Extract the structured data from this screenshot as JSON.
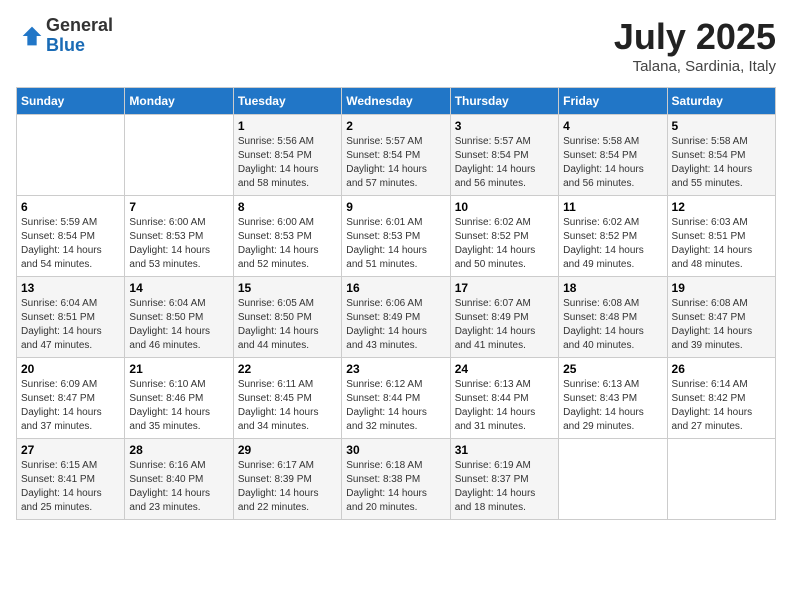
{
  "header": {
    "logo_line1": "General",
    "logo_line2": "Blue",
    "month": "July 2025",
    "location": "Talana, Sardinia, Italy"
  },
  "weekdays": [
    "Sunday",
    "Monday",
    "Tuesday",
    "Wednesday",
    "Thursday",
    "Friday",
    "Saturday"
  ],
  "weeks": [
    [
      {
        "day": "",
        "sunrise": "",
        "sunset": "",
        "daylight": ""
      },
      {
        "day": "",
        "sunrise": "",
        "sunset": "",
        "daylight": ""
      },
      {
        "day": "1",
        "sunrise": "Sunrise: 5:56 AM",
        "sunset": "Sunset: 8:54 PM",
        "daylight": "Daylight: 14 hours and 58 minutes."
      },
      {
        "day": "2",
        "sunrise": "Sunrise: 5:57 AM",
        "sunset": "Sunset: 8:54 PM",
        "daylight": "Daylight: 14 hours and 57 minutes."
      },
      {
        "day": "3",
        "sunrise": "Sunrise: 5:57 AM",
        "sunset": "Sunset: 8:54 PM",
        "daylight": "Daylight: 14 hours and 56 minutes."
      },
      {
        "day": "4",
        "sunrise": "Sunrise: 5:58 AM",
        "sunset": "Sunset: 8:54 PM",
        "daylight": "Daylight: 14 hours and 56 minutes."
      },
      {
        "day": "5",
        "sunrise": "Sunrise: 5:58 AM",
        "sunset": "Sunset: 8:54 PM",
        "daylight": "Daylight: 14 hours and 55 minutes."
      }
    ],
    [
      {
        "day": "6",
        "sunrise": "Sunrise: 5:59 AM",
        "sunset": "Sunset: 8:54 PM",
        "daylight": "Daylight: 14 hours and 54 minutes."
      },
      {
        "day": "7",
        "sunrise": "Sunrise: 6:00 AM",
        "sunset": "Sunset: 8:53 PM",
        "daylight": "Daylight: 14 hours and 53 minutes."
      },
      {
        "day": "8",
        "sunrise": "Sunrise: 6:00 AM",
        "sunset": "Sunset: 8:53 PM",
        "daylight": "Daylight: 14 hours and 52 minutes."
      },
      {
        "day": "9",
        "sunrise": "Sunrise: 6:01 AM",
        "sunset": "Sunset: 8:53 PM",
        "daylight": "Daylight: 14 hours and 51 minutes."
      },
      {
        "day": "10",
        "sunrise": "Sunrise: 6:02 AM",
        "sunset": "Sunset: 8:52 PM",
        "daylight": "Daylight: 14 hours and 50 minutes."
      },
      {
        "day": "11",
        "sunrise": "Sunrise: 6:02 AM",
        "sunset": "Sunset: 8:52 PM",
        "daylight": "Daylight: 14 hours and 49 minutes."
      },
      {
        "day": "12",
        "sunrise": "Sunrise: 6:03 AM",
        "sunset": "Sunset: 8:51 PM",
        "daylight": "Daylight: 14 hours and 48 minutes."
      }
    ],
    [
      {
        "day": "13",
        "sunrise": "Sunrise: 6:04 AM",
        "sunset": "Sunset: 8:51 PM",
        "daylight": "Daylight: 14 hours and 47 minutes."
      },
      {
        "day": "14",
        "sunrise": "Sunrise: 6:04 AM",
        "sunset": "Sunset: 8:50 PM",
        "daylight": "Daylight: 14 hours and 46 minutes."
      },
      {
        "day": "15",
        "sunrise": "Sunrise: 6:05 AM",
        "sunset": "Sunset: 8:50 PM",
        "daylight": "Daylight: 14 hours and 44 minutes."
      },
      {
        "day": "16",
        "sunrise": "Sunrise: 6:06 AM",
        "sunset": "Sunset: 8:49 PM",
        "daylight": "Daylight: 14 hours and 43 minutes."
      },
      {
        "day": "17",
        "sunrise": "Sunrise: 6:07 AM",
        "sunset": "Sunset: 8:49 PM",
        "daylight": "Daylight: 14 hours and 41 minutes."
      },
      {
        "day": "18",
        "sunrise": "Sunrise: 6:08 AM",
        "sunset": "Sunset: 8:48 PM",
        "daylight": "Daylight: 14 hours and 40 minutes."
      },
      {
        "day": "19",
        "sunrise": "Sunrise: 6:08 AM",
        "sunset": "Sunset: 8:47 PM",
        "daylight": "Daylight: 14 hours and 39 minutes."
      }
    ],
    [
      {
        "day": "20",
        "sunrise": "Sunrise: 6:09 AM",
        "sunset": "Sunset: 8:47 PM",
        "daylight": "Daylight: 14 hours and 37 minutes."
      },
      {
        "day": "21",
        "sunrise": "Sunrise: 6:10 AM",
        "sunset": "Sunset: 8:46 PM",
        "daylight": "Daylight: 14 hours and 35 minutes."
      },
      {
        "day": "22",
        "sunrise": "Sunrise: 6:11 AM",
        "sunset": "Sunset: 8:45 PM",
        "daylight": "Daylight: 14 hours and 34 minutes."
      },
      {
        "day": "23",
        "sunrise": "Sunrise: 6:12 AM",
        "sunset": "Sunset: 8:44 PM",
        "daylight": "Daylight: 14 hours and 32 minutes."
      },
      {
        "day": "24",
        "sunrise": "Sunrise: 6:13 AM",
        "sunset": "Sunset: 8:44 PM",
        "daylight": "Daylight: 14 hours and 31 minutes."
      },
      {
        "day": "25",
        "sunrise": "Sunrise: 6:13 AM",
        "sunset": "Sunset: 8:43 PM",
        "daylight": "Daylight: 14 hours and 29 minutes."
      },
      {
        "day": "26",
        "sunrise": "Sunrise: 6:14 AM",
        "sunset": "Sunset: 8:42 PM",
        "daylight": "Daylight: 14 hours and 27 minutes."
      }
    ],
    [
      {
        "day": "27",
        "sunrise": "Sunrise: 6:15 AM",
        "sunset": "Sunset: 8:41 PM",
        "daylight": "Daylight: 14 hours and 25 minutes."
      },
      {
        "day": "28",
        "sunrise": "Sunrise: 6:16 AM",
        "sunset": "Sunset: 8:40 PM",
        "daylight": "Daylight: 14 hours and 23 minutes."
      },
      {
        "day": "29",
        "sunrise": "Sunrise: 6:17 AM",
        "sunset": "Sunset: 8:39 PM",
        "daylight": "Daylight: 14 hours and 22 minutes."
      },
      {
        "day": "30",
        "sunrise": "Sunrise: 6:18 AM",
        "sunset": "Sunset: 8:38 PM",
        "daylight": "Daylight: 14 hours and 20 minutes."
      },
      {
        "day": "31",
        "sunrise": "Sunrise: 6:19 AM",
        "sunset": "Sunset: 8:37 PM",
        "daylight": "Daylight: 14 hours and 18 minutes."
      },
      {
        "day": "",
        "sunrise": "",
        "sunset": "",
        "daylight": ""
      },
      {
        "day": "",
        "sunrise": "",
        "sunset": "",
        "daylight": ""
      }
    ]
  ]
}
